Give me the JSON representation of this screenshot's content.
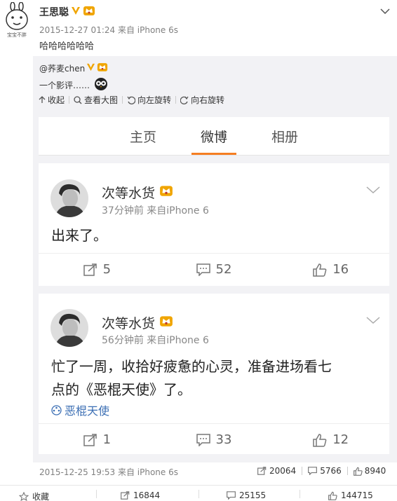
{
  "post": {
    "author": "王思聪",
    "avatar_caption": "宝宝不胖",
    "meta": "2015-12-27 01:24 来自 iPhone 6s",
    "text": "哈哈哈哈哈哈"
  },
  "repost": {
    "user": "@荞麦chen",
    "text": "一个影评……",
    "tools": [
      "收起",
      "查看大图",
      "向左旋转",
      "向右旋转"
    ]
  },
  "embedded": {
    "tabs": [
      "主页",
      "微博",
      "相册"
    ],
    "active_tab": "微博",
    "cards": [
      {
        "name": "次等水货",
        "meta": "37分钟前  来自iPhone 6",
        "body": "出来了。",
        "tag": "",
        "reposts": "5",
        "comments": "52",
        "likes": "16"
      },
      {
        "name": "次等水货",
        "meta": "56分钟前  来自iPhone 6",
        "body_line1": "忙了一周，收拾好疲惫的心灵，准备进场看七",
        "body_line2": "点的《恶棍天使》了。",
        "tag": "恶棍天使",
        "reposts": "1",
        "comments": "33",
        "likes": "12"
      }
    ]
  },
  "repost_footer": {
    "meta": "2015-12-25 19:53 来自 iPhone 6s",
    "reposts": "20064",
    "comments": "5766",
    "likes": "8940"
  },
  "bottom_bar": {
    "favorite": "收藏",
    "reposts": "16844",
    "comments": "25155",
    "likes": "144715"
  },
  "colors": {
    "accent": "#f57e22",
    "verified": "#f0a500",
    "repost_bg": "#f2f2f5"
  }
}
